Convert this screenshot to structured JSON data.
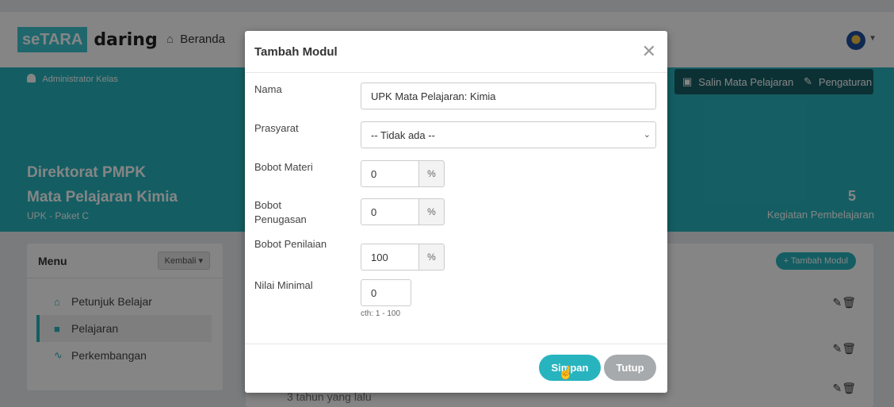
{
  "navbar": {
    "logo_se": "seTARA",
    "logo_daring": "daring",
    "home_label": "Beranda"
  },
  "banner": {
    "admin_label": "Administrator Kelas",
    "copy_button": "Salin Mata Pelajaran",
    "settings_button": "Pengaturan",
    "org_title": "Direktorat PMPK",
    "course_title": "Mata Pelajaran Kimia",
    "course_subtitle": "UPK - Paket C",
    "stat_value": "5",
    "stat_label": "Kegiatan Pembelajaran"
  },
  "menu": {
    "title": "Menu",
    "back_button": "Kembali",
    "items": [
      {
        "label": "Petunjuk Belajar",
        "icon": "home-icon"
      },
      {
        "label": "Pelajaran",
        "icon": "book-icon"
      },
      {
        "label": "Perkembangan",
        "icon": "activity-icon"
      }
    ]
  },
  "content": {
    "add_module_button": "+ Tambah Modul",
    "row_time": "3 tahun yang lalu"
  },
  "modal": {
    "title": "Tambah Modul",
    "fields": {
      "nama": {
        "label": "Nama",
        "value": "UPK Mata Pelajaran: Kimia"
      },
      "prasyarat": {
        "label": "Prasyarat",
        "value": "-- Tidak ada --"
      },
      "bobot_materi": {
        "label": "Bobot Materi",
        "value": "0",
        "unit": "%"
      },
      "bobot_penugasan": {
        "label_line1": "Bobot",
        "label_line2": "Penugasan",
        "value": "0",
        "unit": "%"
      },
      "bobot_penilaian": {
        "label": "Bobot Penilaian",
        "value": "100",
        "unit": "%"
      },
      "nilai_minimal": {
        "label": "Nilai Minimal",
        "value": "0",
        "help": "cth: 1 - 100"
      }
    },
    "save_button": "Simpan",
    "close_button": "Tutup"
  },
  "colors": {
    "accent": "#27b4bf",
    "banner": "#27b4bf",
    "dark_button": "#175e66",
    "close_button": "#a7aaad"
  }
}
